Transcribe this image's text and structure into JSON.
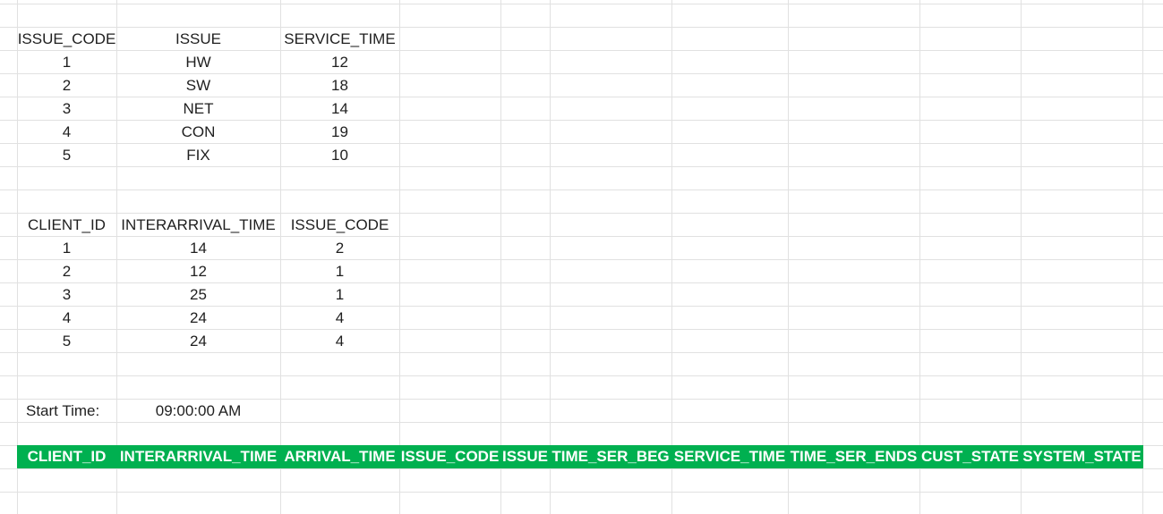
{
  "issue_table": {
    "headers": [
      "ISSUE_CODE",
      "ISSUE",
      "SERVICE_TIME"
    ],
    "rows": [
      [
        "1",
        "HW",
        "12"
      ],
      [
        "2",
        "SW",
        "18"
      ],
      [
        "3",
        "NET",
        "14"
      ],
      [
        "4",
        "CON",
        "19"
      ],
      [
        "5",
        "FIX",
        "10"
      ]
    ]
  },
  "client_table": {
    "headers": [
      "CLIENT_ID",
      "INTERARRIVAL_TIME",
      "ISSUE_CODE"
    ],
    "rows": [
      [
        "1",
        "14",
        "2"
      ],
      [
        "2",
        "12",
        "1"
      ],
      [
        "3",
        "25",
        "1"
      ],
      [
        "4",
        "24",
        "4"
      ],
      [
        "5",
        "24",
        "4"
      ]
    ]
  },
  "start_time": {
    "label": "Start Time:",
    "value": "09:00:00 AM"
  },
  "simulation_header": {
    "fill_color": "#00b050",
    "text_color": "#ffffff",
    "columns": [
      "CLIENT_ID",
      "INTERARRIVAL_TIME",
      "ARRIVAL_TIME",
      "ISSUE_CODE",
      "ISSUE",
      "TIME_SER_BEG",
      "SERVICE_TIME",
      "TIME_SER_ENDS",
      "CUST_STATE",
      "SYSTEM_STATE"
    ]
  }
}
